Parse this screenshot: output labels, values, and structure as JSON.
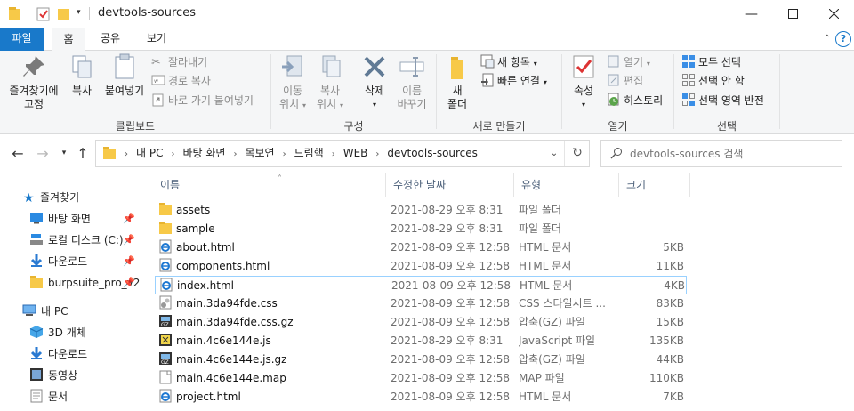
{
  "window": {
    "title": "devtools-sources"
  },
  "ribbon_tabs": [
    "파일",
    "홈",
    "공유",
    "보기"
  ],
  "ribbon": {
    "clipboard": {
      "pin_label_1": "즐겨찾기에",
      "pin_label_2": "고정",
      "copy_label": "복사",
      "paste_label": "붙여넣기",
      "cut_label": "잘라내기",
      "copy_path_label": "경로 복사",
      "paste_shortcut_label": "바로 가기 붙여넣기",
      "group_label": "클립보드"
    },
    "organize": {
      "move_label_1": "이동",
      "move_label_2": "위치",
      "copyto_label_1": "복사",
      "copyto_label_2": "위치",
      "delete_label": "삭제",
      "rename_label_1": "이름",
      "rename_label_2": "바꾸기",
      "group_label": "구성"
    },
    "new": {
      "folder_label_1": "새",
      "folder_label_2": "폴더",
      "new_item_label": "새 항목",
      "easy_access_label": "빠른 연결",
      "group_label": "새로 만들기"
    },
    "open": {
      "properties_label": "속성",
      "open_label": "열기",
      "edit_label": "편집",
      "history_label": "히스토리",
      "group_label": "열기"
    },
    "select": {
      "select_all_label": "모두 선택",
      "select_none_label": "선택 안 함",
      "invert_label": "선택 영역 반전",
      "group_label": "선택"
    }
  },
  "address": {
    "crumbs": [
      "내 PC",
      "바탕 화면",
      "목보연",
      "드림핵",
      "WEB",
      "devtools-sources"
    ]
  },
  "search": {
    "placeholder": "devtools-sources 검색"
  },
  "nav_pane": {
    "quick_access": "즐겨찾기",
    "desktop": "바탕 화면",
    "local_disk": "로컬 디스크 (C:)",
    "downloads": "다운로드",
    "burpsuite": "burpsuite_pro_v2",
    "this_pc": "내 PC",
    "objects3d": "3D 개체",
    "downloads2": "다운로드",
    "videos": "동영상",
    "documents": "문서"
  },
  "columns": {
    "name": "이름",
    "date": "수정한 날짜",
    "type": "유형",
    "size": "크기"
  },
  "files": [
    {
      "name": "assets",
      "date": "2021-08-29 오후 8:31",
      "type": "파일 폴더",
      "size": "",
      "icon": "folder-icon"
    },
    {
      "name": "sample",
      "date": "2021-08-29 오후 8:31",
      "type": "파일 폴더",
      "size": "",
      "icon": "folder-icon"
    },
    {
      "name": "about.html",
      "date": "2021-08-09 오후 12:58",
      "type": "HTML 문서",
      "size": "5KB",
      "icon": "html-icon"
    },
    {
      "name": "components.html",
      "date": "2021-08-09 오후 12:58",
      "type": "HTML 문서",
      "size": "11KB",
      "icon": "html-icon"
    },
    {
      "name": "index.html",
      "date": "2021-08-09 오후 12:58",
      "type": "HTML 문서",
      "size": "4KB",
      "icon": "html-icon",
      "selected": true
    },
    {
      "name": "main.3da94fde.css",
      "date": "2021-08-09 오후 12:58",
      "type": "CSS 스타일시트 ...",
      "size": "83KB",
      "icon": "css-icon"
    },
    {
      "name": "main.3da94fde.css.gz",
      "date": "2021-08-09 오후 12:58",
      "type": "압축(GZ) 파일",
      "size": "15KB",
      "icon": "gz-icon"
    },
    {
      "name": "main.4c6e144e.js",
      "date": "2021-08-29 오후 8:31",
      "type": "JavaScript 파일",
      "size": "135KB",
      "icon": "js-icon"
    },
    {
      "name": "main.4c6e144e.js.gz",
      "date": "2021-08-09 오후 12:58",
      "type": "압축(GZ) 파일",
      "size": "44KB",
      "icon": "gz-icon"
    },
    {
      "name": "main.4c6e144e.map",
      "date": "2021-08-09 오후 12:58",
      "type": "MAP 파일",
      "size": "110KB",
      "icon": "file-icon"
    },
    {
      "name": "project.html",
      "date": "2021-08-09 오후 12:58",
      "type": "HTML 문서",
      "size": "7KB",
      "icon": "html-icon"
    }
  ],
  "colors": {
    "accent": "#1979ca",
    "folder": "#f7c948",
    "selection_border": "#99d1ff"
  }
}
